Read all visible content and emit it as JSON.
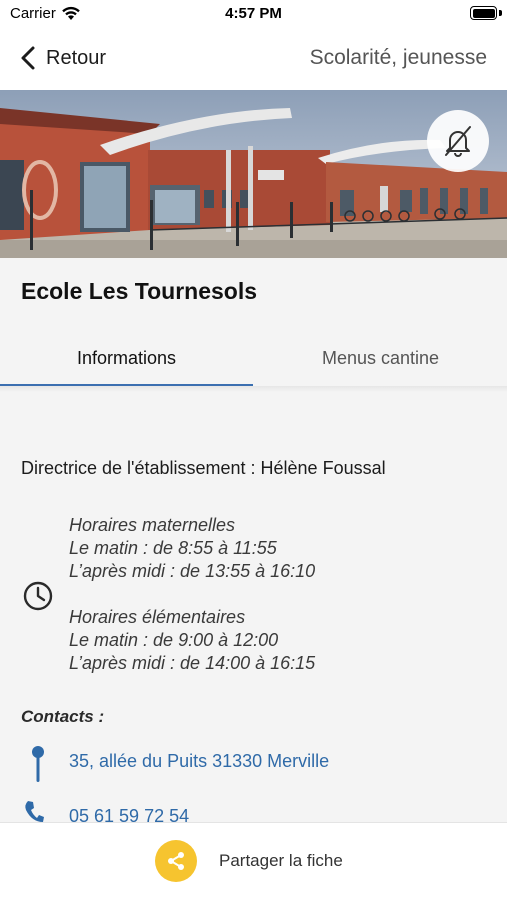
{
  "status_bar": {
    "carrier": "Carrier",
    "time": "4:57 PM",
    "battery_level": 1.0
  },
  "nav": {
    "back_label": "Retour",
    "title": "Scolarité, jeunesse"
  },
  "school": {
    "name": "Ecole Les Tournesols"
  },
  "tabs": [
    {
      "label": "Informations",
      "selected": true
    },
    {
      "label": "Menus cantine",
      "selected": false
    }
  ],
  "info": {
    "director": "Directrice de l'établissement : Hélène Foussal",
    "hours": {
      "maternelle_title": "Horaires maternelles",
      "maternelle_morning": "Le matin : de 8:55 à 11:55",
      "maternelle_afternoon": "L’après midi : de 13:55 à 16:10",
      "elementaire_title": "Horaires élémentaires",
      "elementaire_morning": "Le matin : de 9:00 à 12:00",
      "elementaire_afternoon": "L’après midi : de 14:00 à 16:15"
    },
    "contacts_label": "Contacts :",
    "address": "35, allée du Puits 31330 Merville",
    "phone": "05 61 59 72 54"
  },
  "footer": {
    "share_label": "Partager la fiche"
  },
  "icons": {
    "wifi": "wifi-icon",
    "battery": "battery-icon",
    "back": "chevron-left-icon",
    "bell": "bell-off-icon",
    "clock": "clock-icon",
    "pin": "map-pin-icon",
    "phone": "phone-icon",
    "share": "share-icon"
  },
  "colors": {
    "accent": "#3b6fb0",
    "link": "#2f6aa8",
    "share_button": "#f6c42f"
  }
}
